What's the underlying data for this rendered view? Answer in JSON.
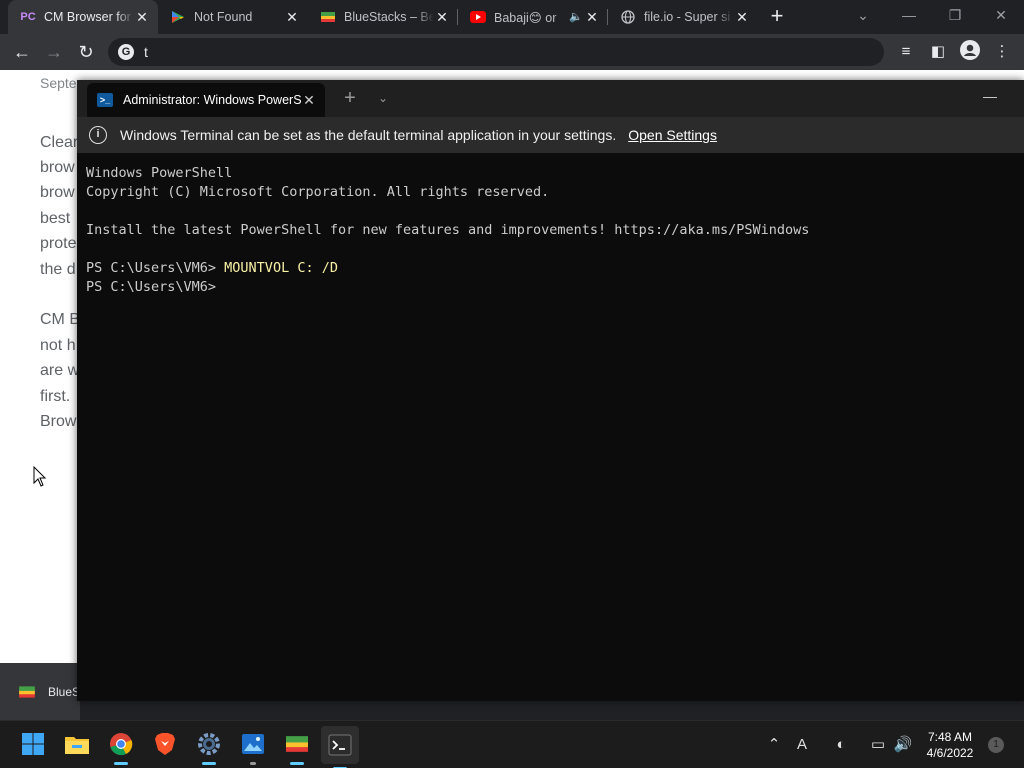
{
  "browser": {
    "tabs": [
      {
        "title": "CM Browser for",
        "favicon": "PC",
        "active": true
      },
      {
        "title": "Not Found",
        "favicon": "play-store-icon"
      },
      {
        "title": "BlueStacks – Be",
        "favicon": "bluestacks-icon"
      },
      {
        "title": "Babaji😊 or",
        "favicon": "youtube-icon",
        "audio": true
      },
      {
        "title": "file.io - Super si",
        "favicon": "globe-icon"
      }
    ],
    "address": "t",
    "colors": {
      "tabstrip": "#202124",
      "toolbar": "#35363a"
    }
  },
  "webpage": {
    "date": "Septe",
    "para1": [
      "Clear",
      "brow",
      "brow",
      "best",
      "prote",
      "the d"
    ],
    "para2": [
      "CM B",
      "not h",
      "are w",
      "first.",
      "Brow"
    ],
    "download_label": "BlueS"
  },
  "terminal": {
    "tab_title": "Administrator: Windows PowerS",
    "info_message": "Windows Terminal can be set as the default terminal application in your settings.",
    "info_link": "Open Settings",
    "lines": [
      "Windows PowerShell",
      "Copyright (C) Microsoft Corporation. All rights reserved.",
      "",
      "Install the latest PowerShell for new features and improvements! https://aka.ms/PSWindows",
      ""
    ],
    "prompt1": "PS C:\\Users\\VM6> ",
    "command1": "MOUNTVOL C: /D",
    "prompt2": "PS C:\\Users\\VM6>",
    "colors": {
      "background": "#0c0c0c",
      "command": "#f9f1a5"
    }
  },
  "taskbar": {
    "apps": [
      "start-icon",
      "file-explorer-icon",
      "chrome-icon",
      "brave-icon",
      "settings-icon",
      "photos-icon",
      "bluestacks-icon",
      "terminal-icon"
    ],
    "time": "7:48 AM",
    "date": "4/6/2022",
    "notifications": "1"
  }
}
